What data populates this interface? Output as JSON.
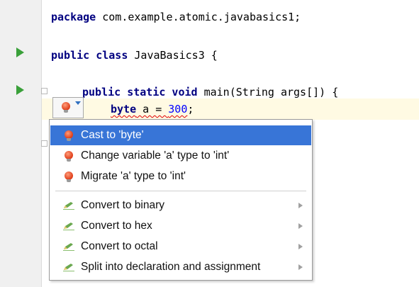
{
  "code": {
    "line1_kw": "package",
    "line1_rest": " com.example.atomic.javabasics1;",
    "line2_kw": "public class",
    "line2_rest": " JavaBasics3 {",
    "line3_kw1": "public static void",
    "line3_rest": " main(String args[]) {",
    "line4_kw": "byte",
    "line4_var": " a = ",
    "line4_num": "300",
    "line4_end": ";"
  },
  "popup": {
    "items": [
      {
        "label": "Cast to 'byte'",
        "icon": "quickfix-bulb-icon",
        "selected": true,
        "submenu": false
      },
      {
        "label": "Change variable 'a' type to 'int'",
        "icon": "quickfix-bulb-icon",
        "selected": false,
        "submenu": false
      },
      {
        "label": "Migrate 'a' type to 'int'",
        "icon": "quickfix-bulb-icon",
        "selected": false,
        "submenu": false
      },
      {
        "label": "Convert to binary",
        "icon": "intention-pencil-icon",
        "selected": false,
        "submenu": true
      },
      {
        "label": "Convert to hex",
        "icon": "intention-pencil-icon",
        "selected": false,
        "submenu": true
      },
      {
        "label": "Convert to octal",
        "icon": "intention-pencil-icon",
        "selected": false,
        "submenu": true
      },
      {
        "label": "Split into declaration and assignment",
        "icon": "intention-pencil-icon",
        "selected": false,
        "submenu": true
      }
    ]
  },
  "colors": {
    "selection": "#3875d7",
    "keyword": "#000080",
    "number": "#0000ff",
    "run_arrow": "#3aa03a",
    "error_bulb": "#e0401c",
    "current_line": "#fffae3"
  }
}
